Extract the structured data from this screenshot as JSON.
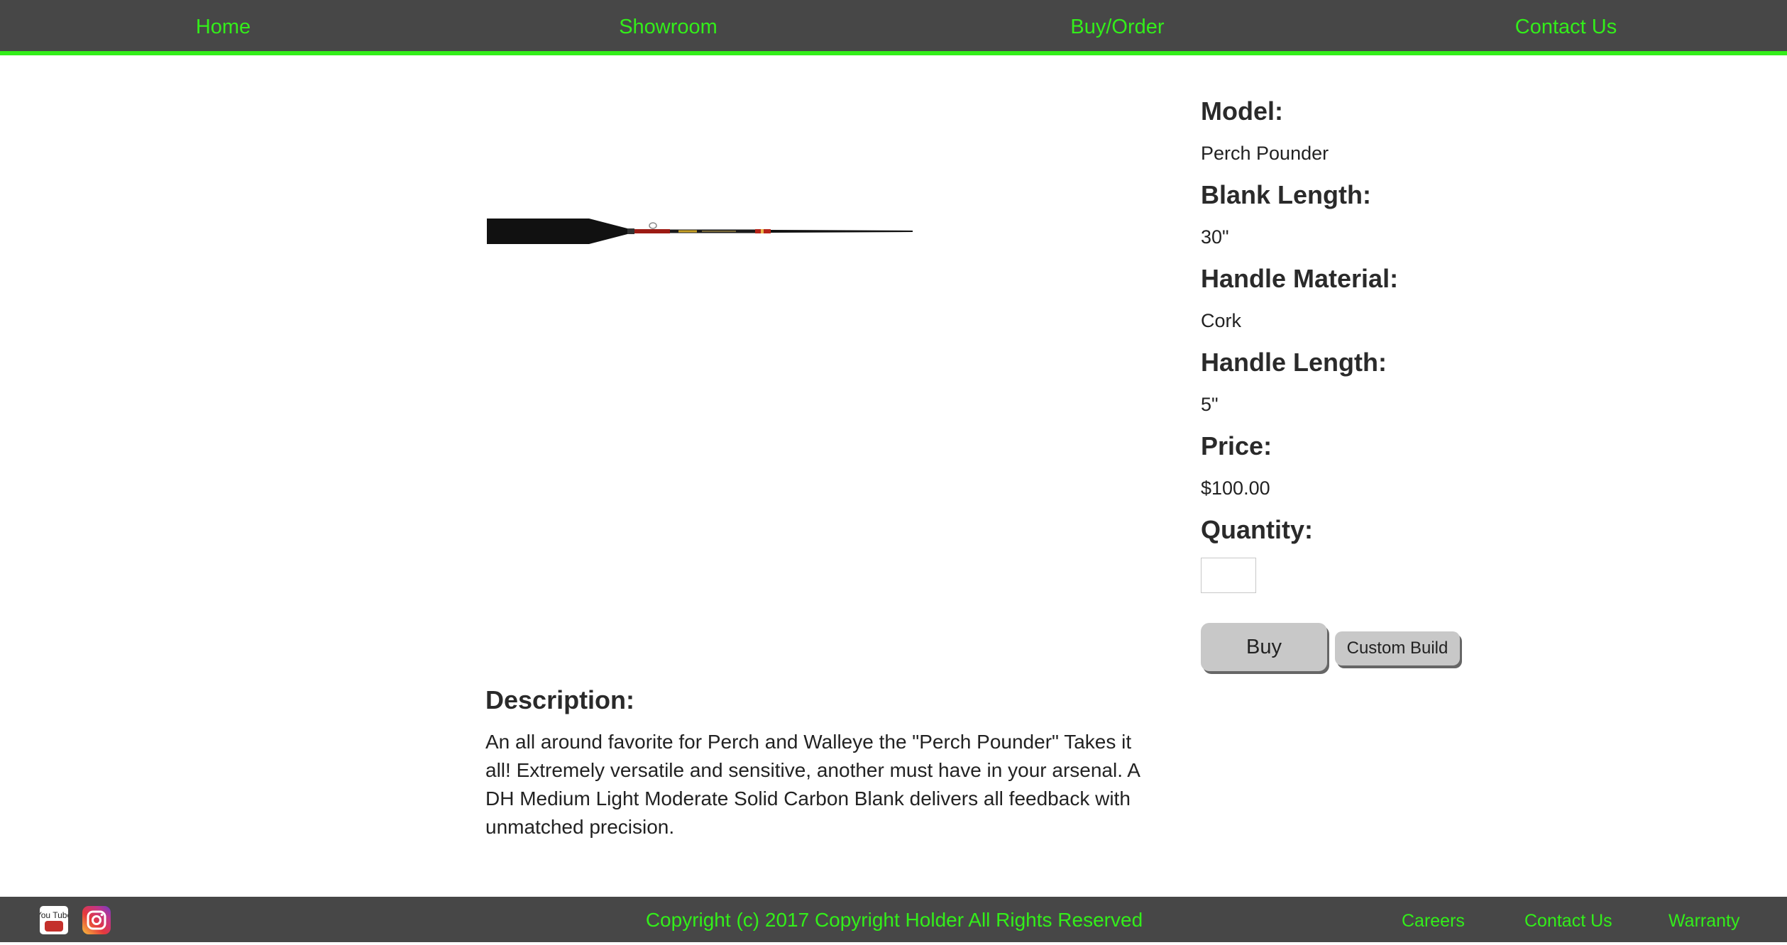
{
  "nav": {
    "items": [
      {
        "label": "Home"
      },
      {
        "label": "Showroom"
      },
      {
        "label": "Buy/Order"
      },
      {
        "label": "Contact Us"
      }
    ]
  },
  "product": {
    "image_icon": "fishing-rod-image",
    "specs": {
      "model_label": "Model:",
      "model_value": "Perch Pounder",
      "blank_length_label": "Blank Length:",
      "blank_length_value": "30\"",
      "handle_material_label": "Handle Material:",
      "handle_material_value": "Cork",
      "handle_length_label": "Handle Length:",
      "handle_length_value": "5\"",
      "price_label": "Price:",
      "price_value": "$100.00",
      "quantity_label": "Quantity:",
      "quantity_value": ""
    },
    "buttons": {
      "buy_label": "Buy",
      "custom_build_label": "Custom Build"
    },
    "description": {
      "heading": "Description:",
      "text": "An all around favorite for Perch and Walleye the \"Perch Pounder\" Takes it all! Extremely versatile and sensitive, another must have in your arsenal. A DH Medium Light Moderate Solid Carbon Blank delivers all feedback with unmatched precision."
    }
  },
  "footer": {
    "social": [
      {
        "icon": "youtube-icon",
        "label": "You Tube"
      },
      {
        "icon": "instagram-icon"
      }
    ],
    "copyright": "Copyright (c) 2017 Copyright Holder All Rights Reserved",
    "links": [
      {
        "label": "Careers"
      },
      {
        "label": "Contact Us"
      },
      {
        "label": "Warranty"
      }
    ]
  },
  "colors": {
    "accent": "#33ee1a",
    "nav_background": "#474747",
    "button_background": "#c8c8c8"
  }
}
